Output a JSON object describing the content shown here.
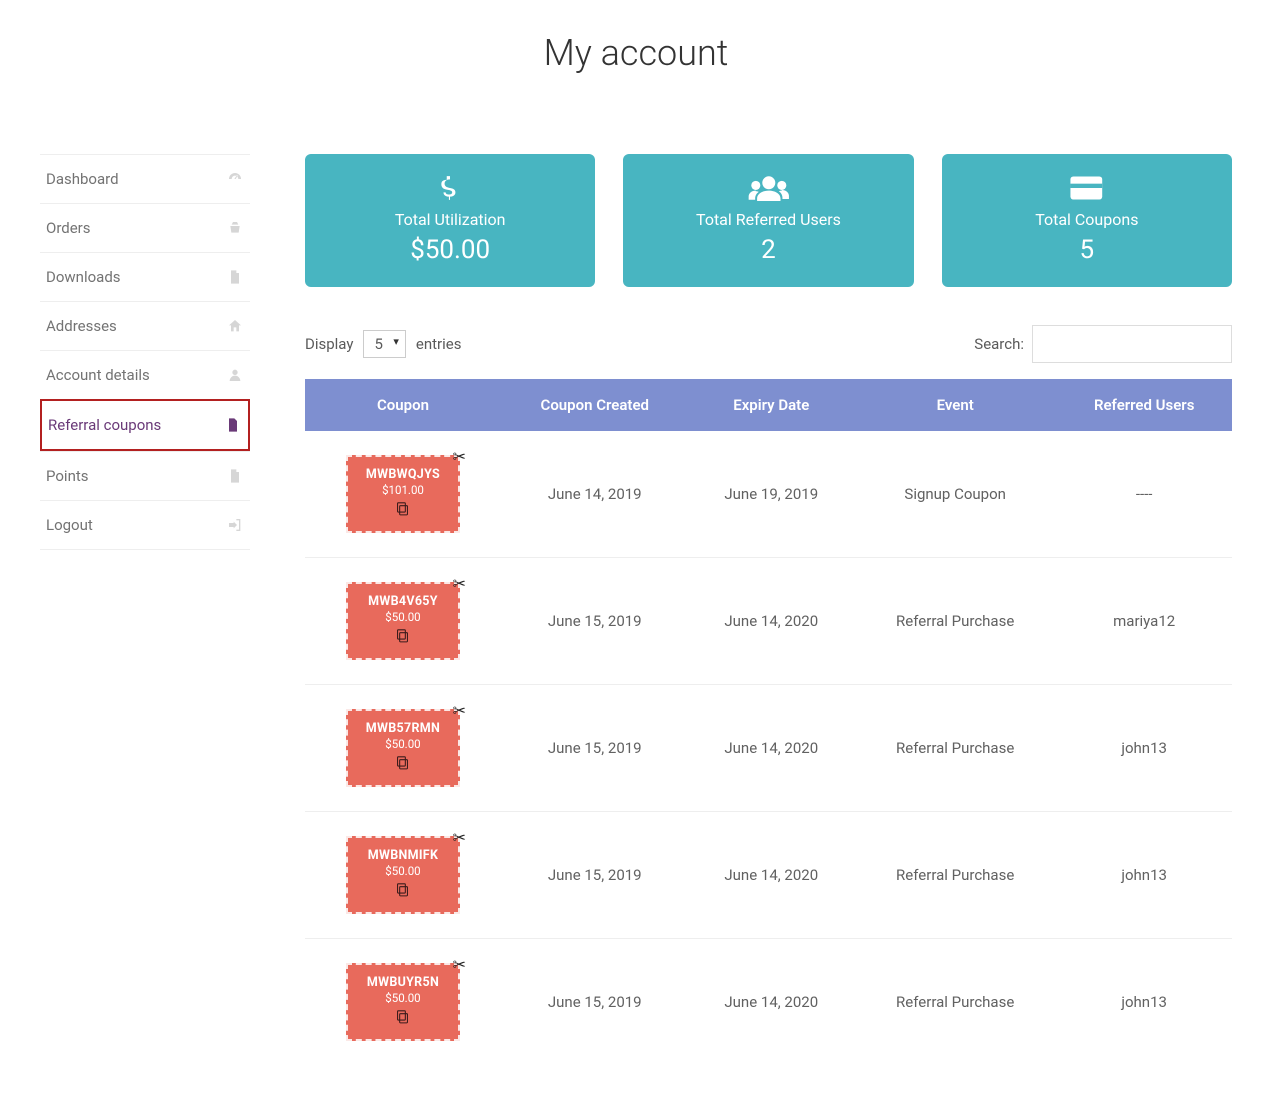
{
  "page_title": "My account",
  "sidebar": {
    "items": [
      {
        "label": "Dashboard",
        "icon": "dashboard-icon",
        "active": false
      },
      {
        "label": "Orders",
        "icon": "basket-icon",
        "active": false
      },
      {
        "label": "Downloads",
        "icon": "file-icon",
        "active": false
      },
      {
        "label": "Addresses",
        "icon": "home-icon",
        "active": false
      },
      {
        "label": "Account details",
        "icon": "user-icon",
        "active": false
      },
      {
        "label": "Referral coupons",
        "icon": "page-icon",
        "active": true
      },
      {
        "label": "Points",
        "icon": "file-icon",
        "active": false
      },
      {
        "label": "Logout",
        "icon": "logout-icon",
        "active": false
      }
    ]
  },
  "stats": [
    {
      "label": "Total Utilization",
      "value": "$50.00",
      "icon": "dollar-icon"
    },
    {
      "label": "Total Referred Users",
      "value": "2",
      "icon": "users-icon"
    },
    {
      "label": "Total Coupons",
      "value": "5",
      "icon": "card-icon"
    }
  ],
  "table_controls": {
    "display_prefix": "Display",
    "display_value": "5",
    "display_suffix": "entries",
    "search_label": "Search:",
    "search_value": ""
  },
  "table": {
    "columns": [
      "Coupon",
      "Coupon Created",
      "Expiry Date",
      "Event",
      "Referred Users"
    ],
    "rows": [
      {
        "code": "MWBWQJYS",
        "amount": "$101.00",
        "created": "June 14, 2019",
        "expiry": "June 19, 2019",
        "event": "Signup Coupon",
        "referred": "----"
      },
      {
        "code": "MWB4V65Y",
        "amount": "$50.00",
        "created": "June 15, 2019",
        "expiry": "June 14, 2020",
        "event": "Referral Purchase",
        "referred": "mariya12"
      },
      {
        "code": "MWB57RMN",
        "amount": "$50.00",
        "created": "June 15, 2019",
        "expiry": "June 14, 2020",
        "event": "Referral Purchase",
        "referred": "john13"
      },
      {
        "code": "MWBNMIFK",
        "amount": "$50.00",
        "created": "June 15, 2019",
        "expiry": "June 14, 2020",
        "event": "Referral Purchase",
        "referred": "john13"
      },
      {
        "code": "MWBUYR5N",
        "amount": "$50.00",
        "created": "June 15, 2019",
        "expiry": "June 14, 2020",
        "event": "Referral Purchase",
        "referred": "john13"
      }
    ]
  },
  "colors": {
    "accent_teal": "#48b5c1",
    "header_purple": "#7e8fd0",
    "coupon_red": "#e86a5c",
    "active_border": "#b32020"
  }
}
